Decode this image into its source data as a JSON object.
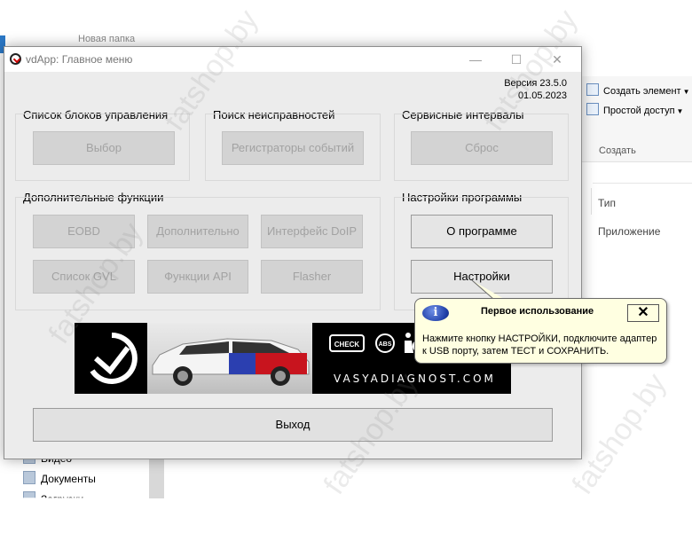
{
  "background": {
    "folder_title": "Новая папка",
    "ribbon": {
      "new_item": "Создать элемент",
      "easy_access": "Простой доступ",
      "group_label": "Создать"
    },
    "columns": {
      "type_header": "Тип",
      "type_value": "Приложение"
    },
    "nav": {
      "videos": "Видео",
      "documents": "Документы",
      "downloads": "Загрузки"
    }
  },
  "window": {
    "title": "vdApp:  Главное меню",
    "version_line1": "Версия 23.5.0",
    "version_line2": "01.05.2023"
  },
  "groups": {
    "control_units": {
      "label": "Список блоков управления",
      "button": "Выбор"
    },
    "fault_search": {
      "label": "Поиск неисправностей",
      "button": "Регистраторы событий"
    },
    "service": {
      "label": "Сервисные интервалы",
      "button": "Сброс"
    },
    "extra": {
      "label": "Дополнительные функции",
      "buttons": [
        "EOBD",
        "Дополнительно",
        "Интерфейс DoIP",
        "Список GVL",
        "Функции API",
        "Flasher"
      ]
    },
    "settings": {
      "label": "Настройки программы",
      "about": "О программе",
      "settings": "Настройки"
    }
  },
  "banner": {
    "url": "VASYADIAGNOST.COM",
    "badge_check": "CHECK",
    "badge_abs": "ABS"
  },
  "exit_button": "Выход",
  "tooltip": {
    "title": "Первое использование",
    "text": "Нажмите кнопку НАСТРОЙКИ, подключите адаптер к USB порту, затем ТЕСТ и СОХРАНИТЬ.",
    "close_glyph": "✕",
    "info_glyph": "i"
  },
  "titlebar": {
    "minimize": "—",
    "maximize": "☐",
    "close": "✕"
  },
  "watermark": "fatshop.by",
  "colors": {
    "button_disabled": "#d3d3d3",
    "tooltip_bg": "#ffffe1",
    "info_blue": "#1f3fa8"
  }
}
